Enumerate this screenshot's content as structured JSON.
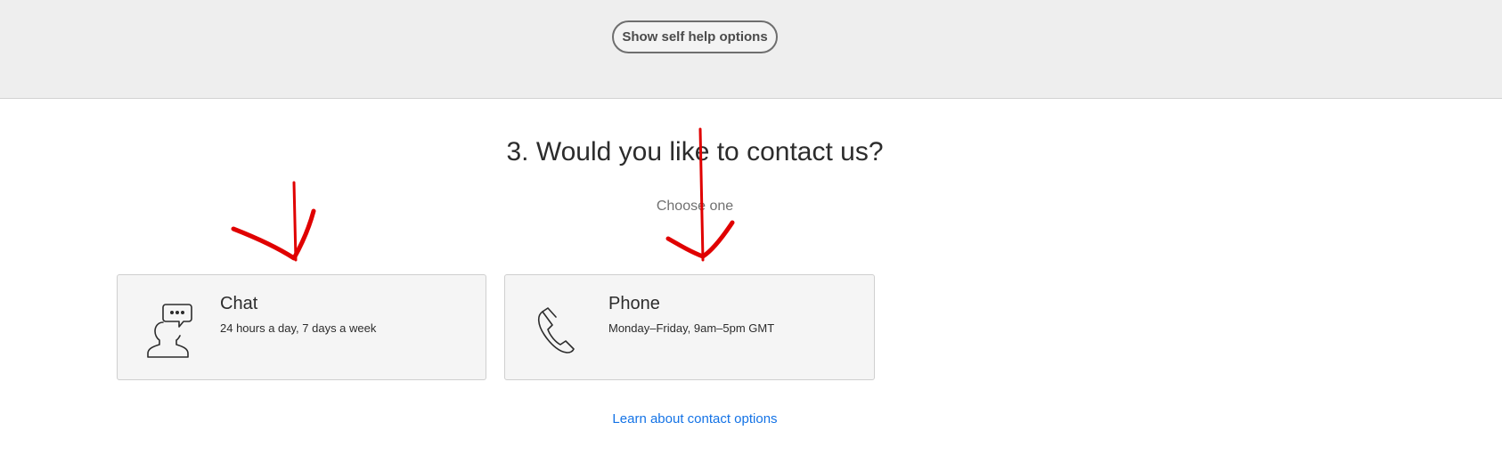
{
  "header": {
    "self_help_label": "Show self help options"
  },
  "section": {
    "title": "3. Would you like to contact us?",
    "subtitle": "Choose one"
  },
  "options": [
    {
      "title": "Chat",
      "description": "24 hours a day, 7 days a week",
      "icon": "chat-person-icon"
    },
    {
      "title": "Phone",
      "description": "Monday–Friday, 9am–5pm GMT",
      "icon": "phone-icon"
    }
  ],
  "footer": {
    "link_label": "Learn about contact options"
  },
  "colors": {
    "band_bg": "#eeeeee",
    "card_bg": "#f5f5f5",
    "link": "#1473e6",
    "annotation": "#e00000"
  }
}
